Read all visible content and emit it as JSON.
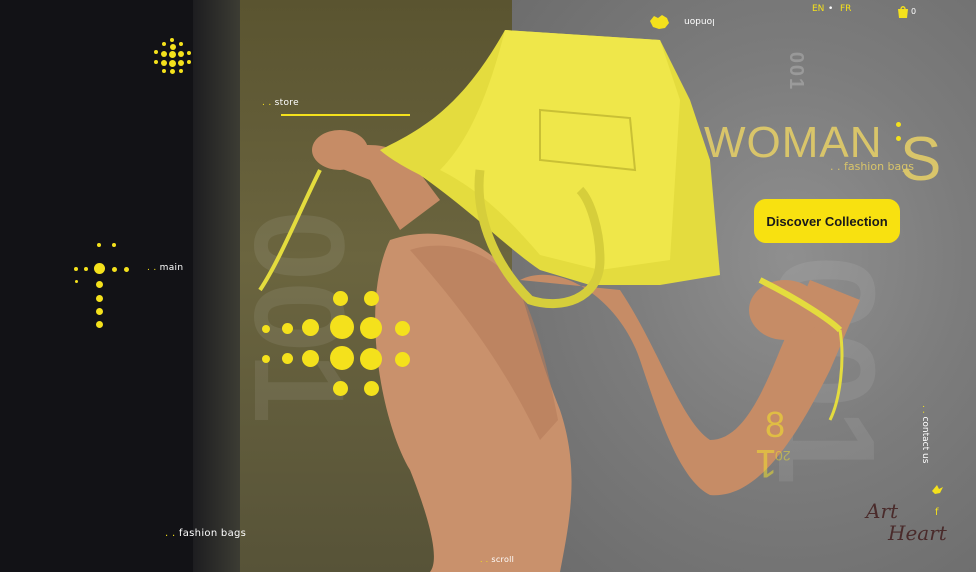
{
  "nav": {
    "store": "store",
    "main": "main",
    "fashion_bags": "fashion bags",
    "scroll": "scroll",
    "contact": "contact us",
    "dots": ". ."
  },
  "header": {
    "lang_en": "EN",
    "lang_fr": "FR",
    "cart_count": "0",
    "city": "london"
  },
  "hero": {
    "title": "WOMAN",
    "title_s": "S",
    "subtitle": ". . fashion bags",
    "cta_label": "Discover Collection",
    "ghost_number": "001",
    "side_number": "001",
    "num_8": "8",
    "num_20": "20",
    "num_1": "1"
  },
  "signature": {
    "line1": "Art",
    "line2": "Heart"
  },
  "colors": {
    "accent": "#f4e11c",
    "panel_left": "#121216",
    "panel_olive": "#6b653f",
    "panel_gray": "#7c7c7c"
  },
  "icons": [
    "dot-logo-icon",
    "cross-dots-icon",
    "arrow-dots-icon",
    "cart-icon",
    "london-map-icon",
    "bird-icon",
    "facebook-icon"
  ]
}
